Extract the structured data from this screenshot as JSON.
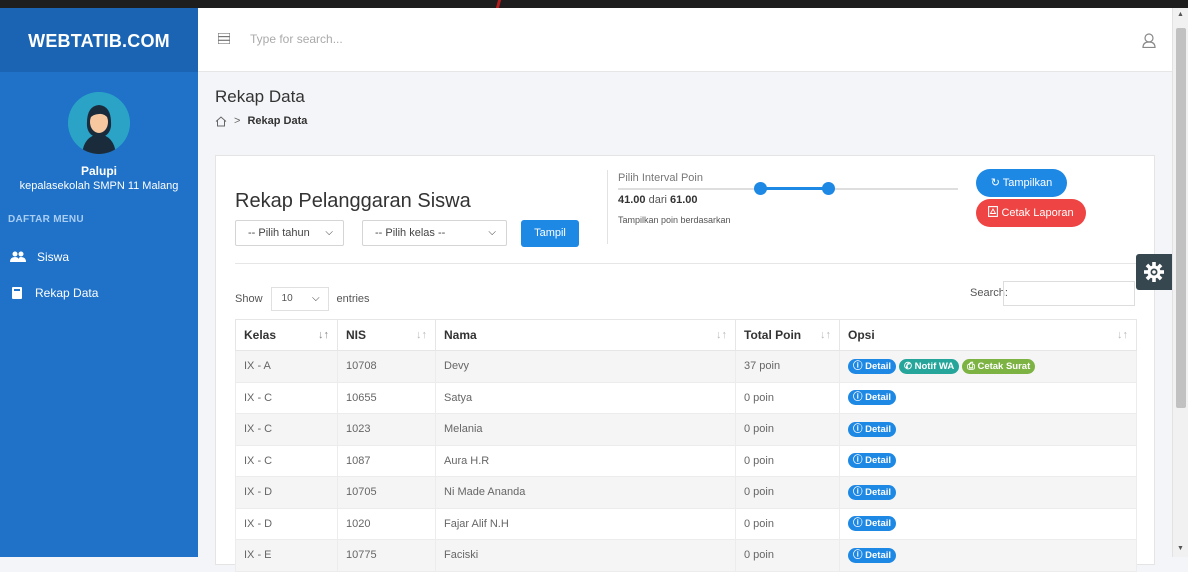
{
  "brand": "WEBTATIB.COM",
  "user": {
    "name": "Palupi",
    "role": "kepalasekolah SMPN 11 Malang"
  },
  "sidebar": {
    "menu_heading": "DAFTAR MENU",
    "items": [
      {
        "label": "Siswa",
        "icon": "users-icon"
      },
      {
        "label": "Rekap Data",
        "icon": "book-icon"
      }
    ]
  },
  "topbar": {
    "search_placeholder": "Type for search..."
  },
  "page": {
    "title": "Rekap Data",
    "breadcrumb_current": "Rekap Data"
  },
  "filter": {
    "heading": "Rekap Pelanggaran Siswa",
    "year_select": "-- Pilih tahun",
    "class_select": "-- Pilih kelas --",
    "submit_label": "Tampil",
    "interval_label": "Pilih Interval Poin",
    "interval_min": "41.00",
    "interval_joiner": "dari",
    "interval_max": "61.00",
    "interval_hint": "Tampilkan poin berdasarkan",
    "show_button": "Tampilkan",
    "print_report_button": "Cetak Laporan"
  },
  "table": {
    "show_label": "Show",
    "page_length": "10",
    "entries_label": "entries",
    "search_label": "Search:",
    "columns": [
      "Kelas",
      "NIS",
      "Nama",
      "Total Poin",
      "Opsi"
    ],
    "badges": {
      "detail": "Detail",
      "wa": "Notif WA",
      "print": "Cetak Surat"
    },
    "rows": [
      {
        "kelas": "IX - A",
        "nis": "10708",
        "nama": "Devy",
        "poin": "37 poin",
        "extra": true
      },
      {
        "kelas": "IX - C",
        "nis": "10655",
        "nama": "Satya",
        "poin": "0 poin",
        "extra": false
      },
      {
        "kelas": "IX - C",
        "nis": "1023",
        "nama": "Melania",
        "poin": "0 poin",
        "extra": false
      },
      {
        "kelas": "IX - C",
        "nis": "1087",
        "nama": "Aura H.R",
        "poin": "0 poin",
        "extra": false
      },
      {
        "kelas": "IX - D",
        "nis": "10705",
        "nama": "Ni Made Ananda",
        "poin": "0 poin",
        "extra": false
      },
      {
        "kelas": "IX - D",
        "nis": "1020",
        "nama": "Fajar Alif N.H",
        "poin": "0 poin",
        "extra": false
      },
      {
        "kelas": "IX - E",
        "nis": "10775",
        "nama": "Faciski",
        "poin": "0 poin",
        "extra": false
      }
    ]
  },
  "colors": {
    "sidebar": "#1f72c8",
    "primary": "#1e88e5",
    "danger": "#ef4444",
    "wa": "#26a69a",
    "print": "#7cb342"
  }
}
